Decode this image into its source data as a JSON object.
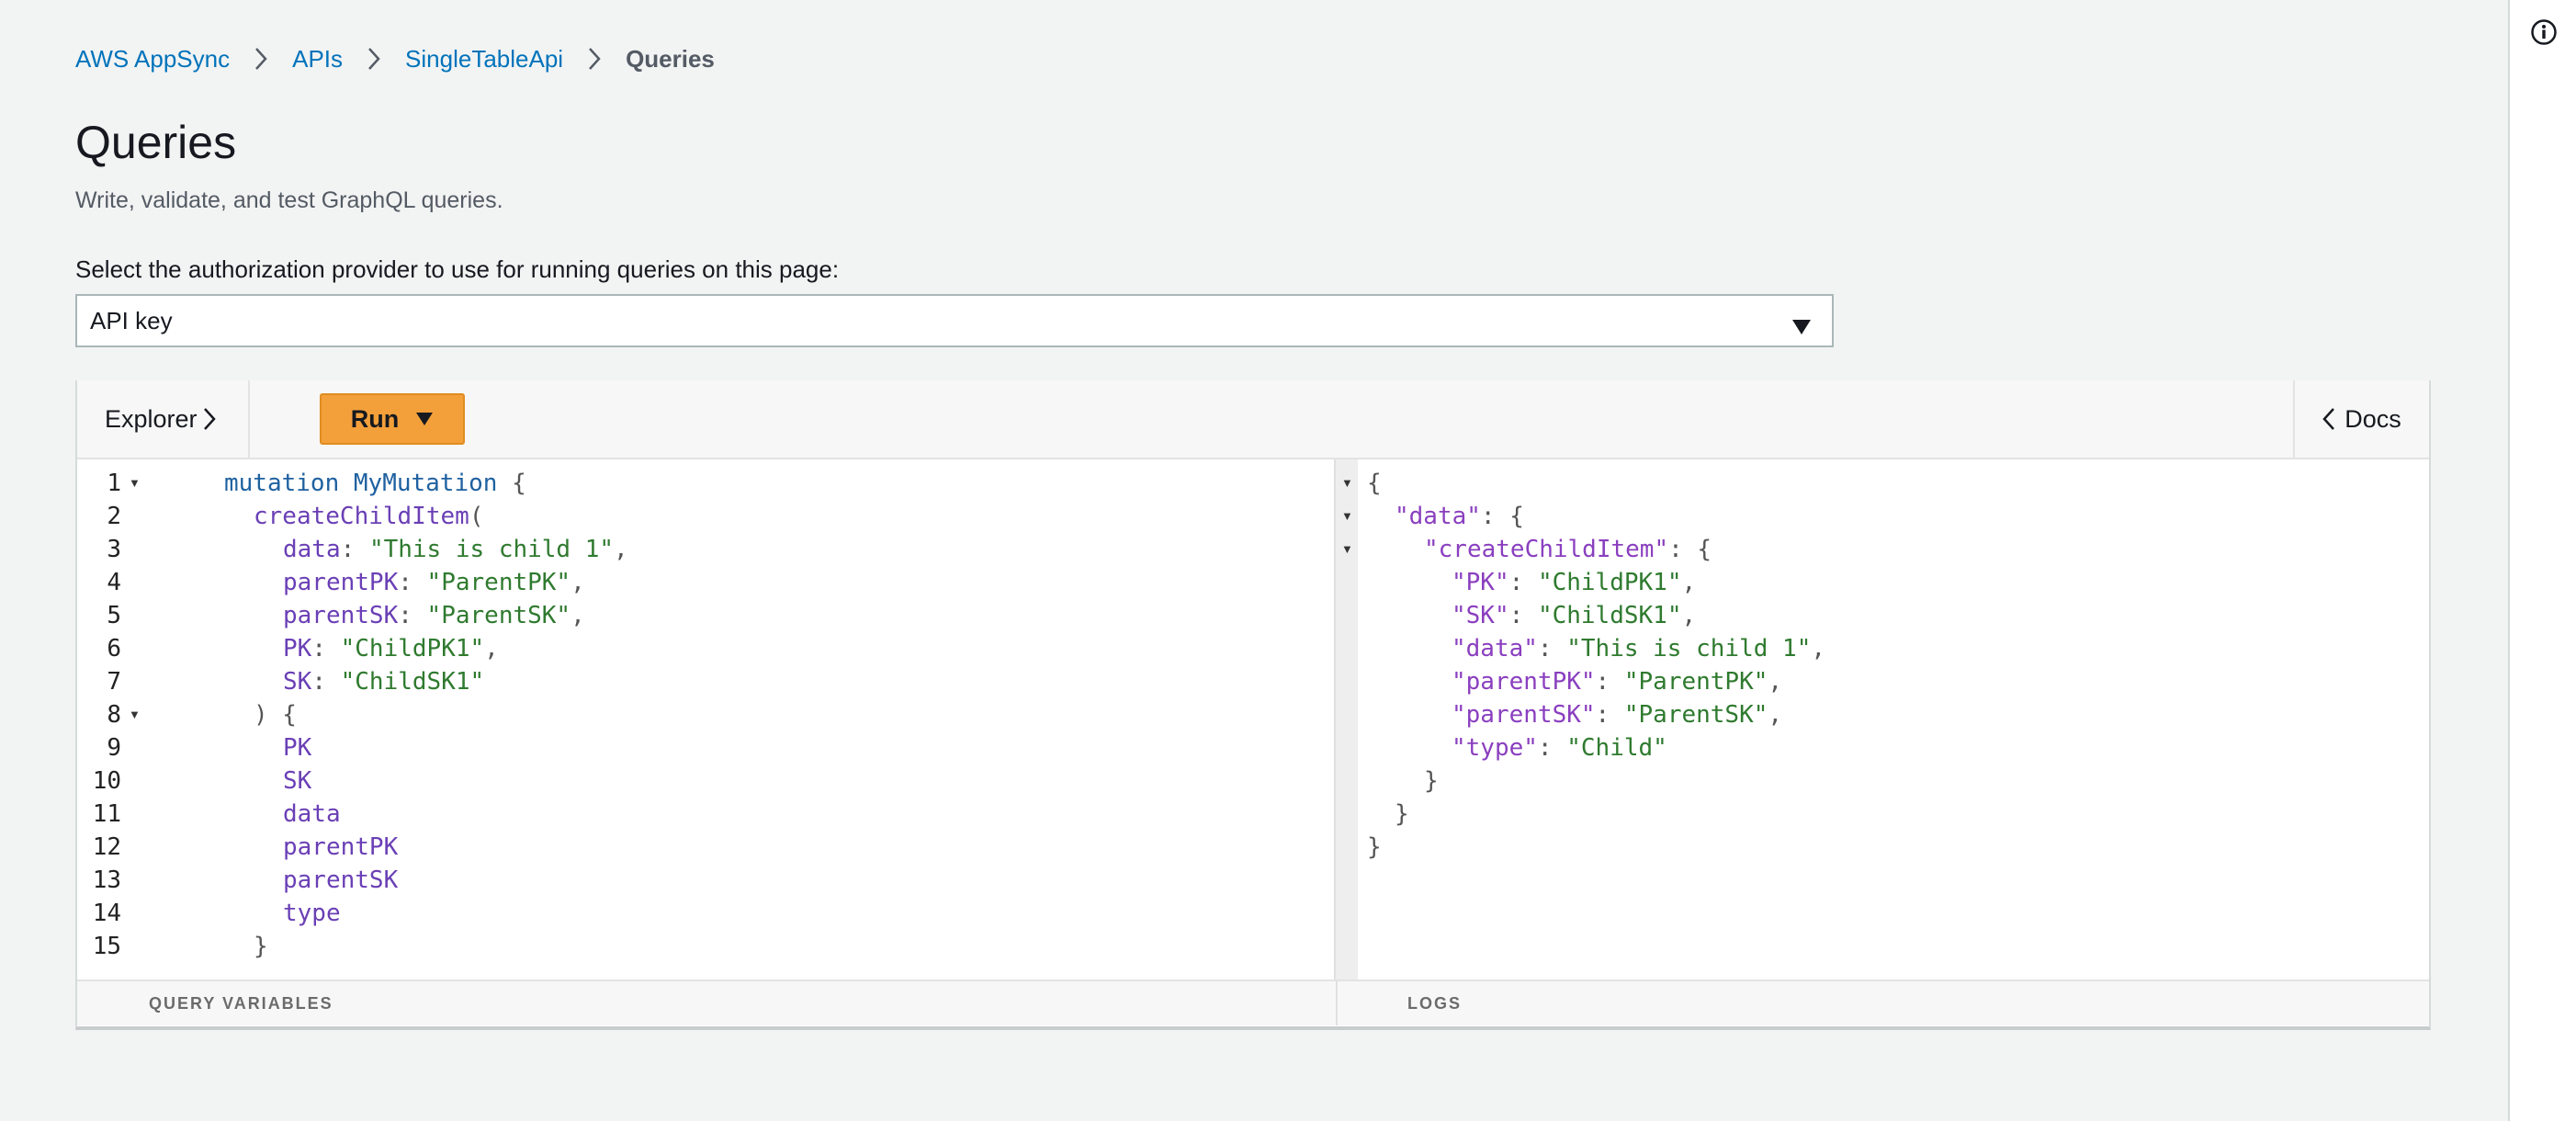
{
  "breadcrumb": {
    "items": [
      "AWS AppSync",
      "APIs",
      "SingleTableApi"
    ],
    "current": "Queries"
  },
  "page": {
    "title": "Queries",
    "description": "Write, validate, and test GraphQL queries."
  },
  "auth": {
    "label": "Select the authorization provider to use for running queries on this page:",
    "selected": "API key"
  },
  "toolbar": {
    "explorer_label": "Explorer",
    "run_label": "Run",
    "docs_label": "Docs"
  },
  "editor": {
    "line_numbers": [
      "1",
      "2",
      "3",
      "4",
      "5",
      "6",
      "7",
      "8",
      "9",
      "10",
      "11",
      "12",
      "13",
      "14",
      "15"
    ],
    "folded_lines": [
      "1",
      "8"
    ],
    "tokens": {
      "mutation": "mutation",
      "op_name": "MyMutation",
      "open_brace": " {",
      "call": "createChildItem",
      "open_paren": "(",
      "args": [
        {
          "key": "data",
          "value": "\"This is child 1\"",
          "trail": ","
        },
        {
          "key": "parentPK",
          "value": "\"ParentPK\"",
          "trail": ","
        },
        {
          "key": "parentSK",
          "value": "\"ParentSK\"",
          "trail": ","
        },
        {
          "key": "PK",
          "value": "\"ChildPK1\"",
          "trail": ","
        },
        {
          "key": "SK",
          "value": "\"ChildSK1\"",
          "trail": ""
        }
      ],
      "close_paren_brace": ") {",
      "fields": [
        "PK",
        "SK",
        "data",
        "parentPK",
        "parentSK",
        "type"
      ],
      "close_brace": "}"
    }
  },
  "result": {
    "open": "{",
    "data_key": "\"data\"",
    "item_key": "\"createChildItem\"",
    "entries": [
      {
        "key": "\"PK\"",
        "value": "\"ChildPK1\"",
        "trail": ","
      },
      {
        "key": "\"SK\"",
        "value": "\"ChildSK1\"",
        "trail": ","
      },
      {
        "key": "\"data\"",
        "value": "\"This is child 1\"",
        "trail": ","
      },
      {
        "key": "\"parentPK\"",
        "value": "\"ParentPK\"",
        "trail": ","
      },
      {
        "key": "\"parentSK\"",
        "value": "\"ParentSK\"",
        "trail": ","
      },
      {
        "key": "\"type\"",
        "value": "\"Child\"",
        "trail": ""
      }
    ],
    "close": "}"
  },
  "bottom": {
    "query_variables_label": "QUERY VARIABLES",
    "logs_label": "LOGS"
  },
  "colors": {
    "run_button": "#f3a03b",
    "link": "#0073bb",
    "string": "#2f7a2f",
    "keyword": "#1f61a0",
    "field": "#6a3fb5"
  },
  "icons": {
    "info": "info-icon",
    "breadcrumb_separator": "chevron-right-icon",
    "select_caret": "caret-down-icon",
    "explorer_chevron": "chevron-right-icon",
    "run_caret": "caret-down-icon",
    "docs_chevron": "chevron-left-icon"
  }
}
